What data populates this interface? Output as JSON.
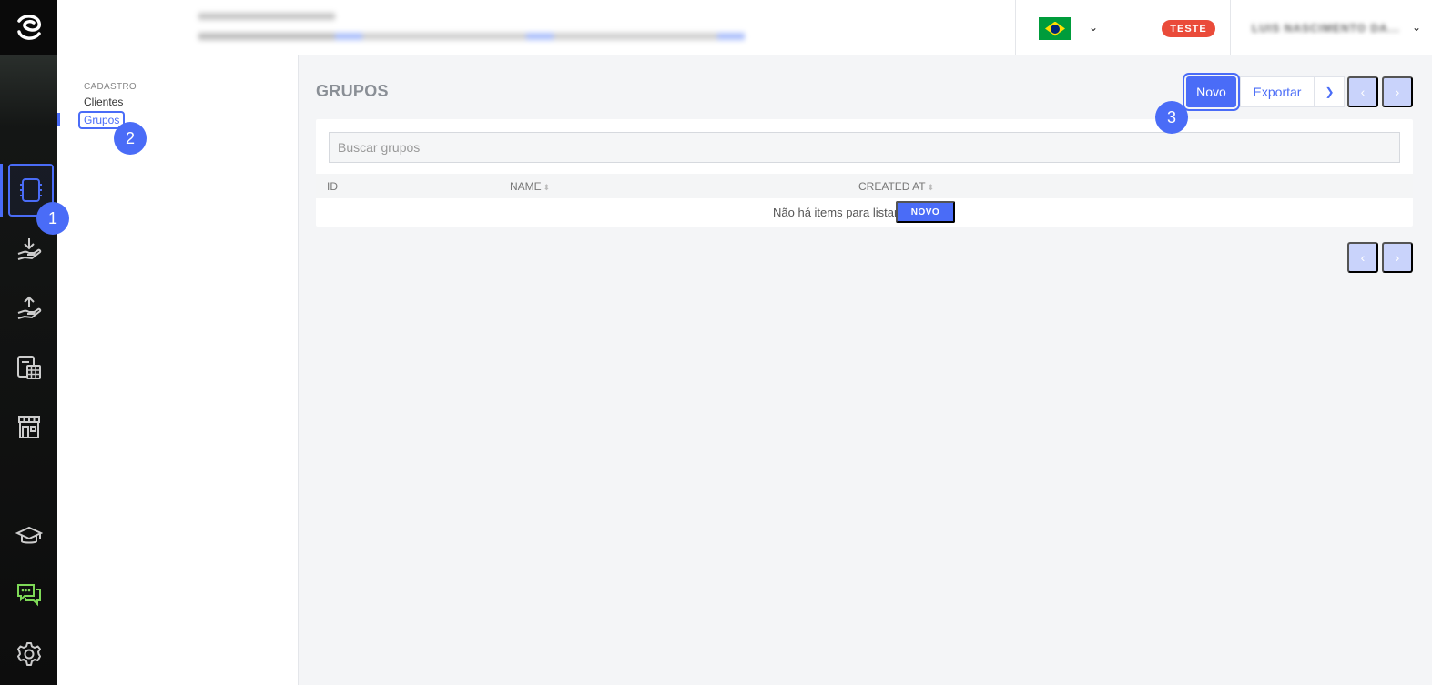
{
  "header": {
    "language_icon": "brazil-flag-icon",
    "environment_badge": "TESTE",
    "user_name": "LUIS NASCIMENTO DA..."
  },
  "rail": {
    "items": [
      {
        "icon": "notebook-icon",
        "active": true
      },
      {
        "icon": "hand-receive-icon"
      },
      {
        "icon": "hand-send-icon"
      },
      {
        "icon": "calculator-icon"
      },
      {
        "icon": "store-icon"
      },
      {
        "icon": "graduation-cap-icon"
      },
      {
        "icon": "chat-icon"
      },
      {
        "icon": "gear-icon"
      }
    ]
  },
  "subnav": {
    "section": "CADASTRO",
    "items": [
      {
        "label": "Clientes"
      },
      {
        "label": "Grupos",
        "active": true
      }
    ]
  },
  "main": {
    "title": "GRUPOS",
    "new_button": "Novo",
    "export_button": "Exportar",
    "prev": "‹",
    "next": "›",
    "search_placeholder": "Buscar grupos",
    "columns": [
      "ID",
      "NAME",
      "CREATED AT"
    ],
    "empty_text": "Não há items para listar.",
    "empty_button": "NOVO"
  },
  "markers": [
    "1",
    "2",
    "3"
  ],
  "colors": {
    "accent": "#4a6cf7",
    "badge": "#ea4b3a",
    "chat": "#7ed957"
  }
}
